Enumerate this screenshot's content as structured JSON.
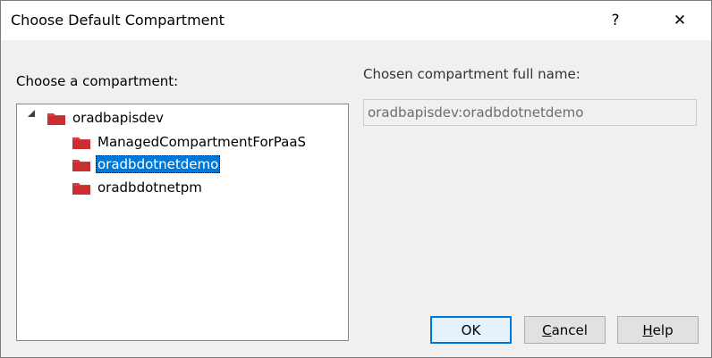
{
  "window": {
    "title": "Choose Default Compartment",
    "help_glyph": "?",
    "close_glyph": "✕"
  },
  "left_label": "Choose a compartment:",
  "right_label": "Chosen compartment full name:",
  "tree": {
    "root": {
      "label": "oradbapisdev",
      "expanded": true,
      "icon": "folder-icon"
    },
    "children": [
      {
        "label": "ManagedCompartmentForPaaS",
        "icon": "folder-icon",
        "selected": false
      },
      {
        "label": "oradbdotnetdemo",
        "icon": "folder-icon",
        "selected": true
      },
      {
        "label": "oradbdotnetpm",
        "icon": "folder-icon",
        "selected": false
      }
    ]
  },
  "full_name_value": "oradbapisdev:oradbdotnetdemo",
  "buttons": {
    "ok": "OK",
    "cancel_first": "C",
    "cancel_rest": "ancel",
    "help_first": "H",
    "help_rest": "elp"
  },
  "colors": {
    "folder": "#e03a3e",
    "selection": "#0078d7"
  }
}
